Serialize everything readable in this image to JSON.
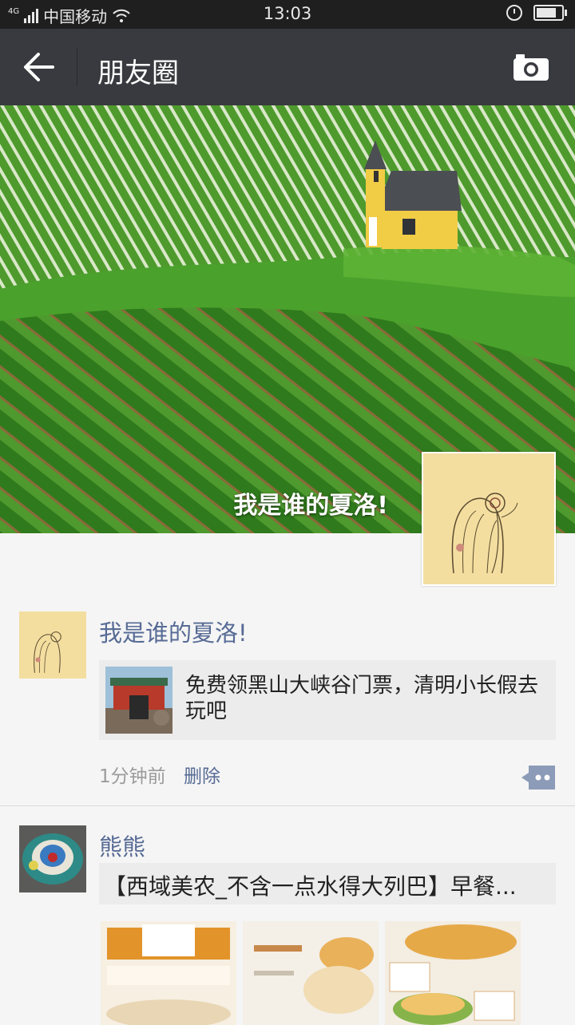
{
  "status_bar": {
    "network": "4G",
    "carrier": "中国移动",
    "time": "13:03",
    "battery_level": 0.85
  },
  "nav": {
    "title": "朋友圈"
  },
  "cover": {
    "username": "我是谁的夏洛!"
  },
  "posts": [
    {
      "name": "我是谁的夏洛!",
      "link_text": "免费领黑山大峡谷门票，清明小长假去玩吧",
      "time": "1分钟前",
      "delete_label": "删除"
    },
    {
      "name": "熊熊",
      "text": "【西域美农_不含一点水得大列巴】早餐..."
    }
  ],
  "icons": {
    "back": "back-arrow-icon",
    "camera": "camera-icon",
    "comment": "comment-icon",
    "wifi": "wifi-icon",
    "alarm": "alarm-icon",
    "battery": "battery-icon"
  }
}
